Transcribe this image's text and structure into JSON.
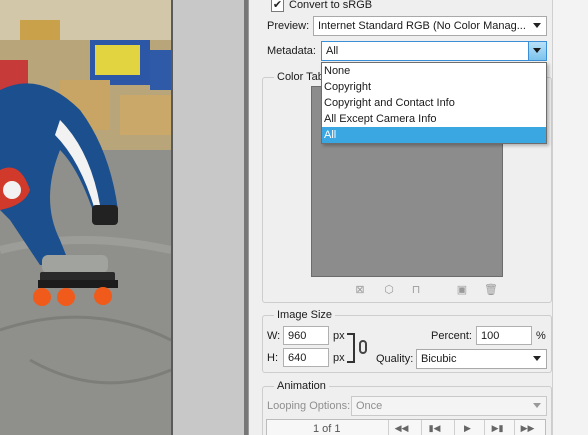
{
  "export": {
    "convert_srgb_label": "Convert to sRGB",
    "convert_srgb_checked": true,
    "preview_label": "Preview:",
    "preview_value": "Internet Standard RGB (No Color Manag...",
    "metadata_label": "Metadata:",
    "metadata_value": "All",
    "metadata_options": [
      "None",
      "Copyright",
      "Copyright and Contact Info",
      "All Except Camera Info",
      "All"
    ],
    "metadata_selected_index": 4,
    "color_table_title": "Color Tab",
    "image_size_title": "Image Size",
    "width_label": "W:",
    "width_value": "960",
    "height_label": "H:",
    "height_value": "640",
    "unit_px": "px",
    "percent_label": "Percent:",
    "percent_value": "100",
    "percent_unit": "%",
    "quality_label": "Quality:",
    "quality_value": "Bicubic",
    "animation_title": "Animation",
    "looping_label": "Looping Options:",
    "looping_value": "Once",
    "frame_counter": "1 of 1"
  },
  "icons": [
    "checkmark-icon",
    "dropdown-caret-icon",
    "link-chain-icon",
    "first-frame-icon",
    "previous-frame-icon",
    "play-icon",
    "next-frame-icon",
    "last-frame-icon",
    "trash-icon"
  ],
  "colors": {
    "panel_bg": "#efefef",
    "accent_blue": "#3aa6e2",
    "color_table_gray": "#8c8c8c"
  }
}
